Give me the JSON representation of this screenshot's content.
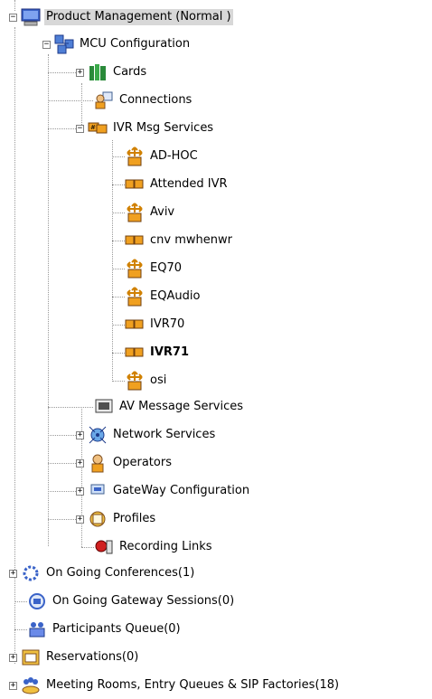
{
  "tree": {
    "root": "Product Management   (Normal )",
    "mcu": "MCU Configuration",
    "cards": "Cards",
    "connections": "Connections",
    "ivr": "IVR Msg Services",
    "ivr_items": [
      "AD-HOC",
      "Attended IVR",
      "Aviv",
      "cnv mwhenwr",
      "EQ70",
      "EQAudio",
      "IVR70",
      "IVR71",
      "osi"
    ],
    "av": "AV Message Services",
    "network": "Network Services",
    "operators": "Operators",
    "gateway": "GateWay Configuration",
    "profiles": "Profiles",
    "recording": "Recording Links",
    "ongoing_conf": "On Going Conferences(1)",
    "ongoing_gw": "On Going Gateway Sessions(0)",
    "participants": "Participants Queue(0)",
    "reservations": "Reservations(0)",
    "meeting": "Meeting Rooms, Entry Queues & SIP Factories(18)"
  }
}
